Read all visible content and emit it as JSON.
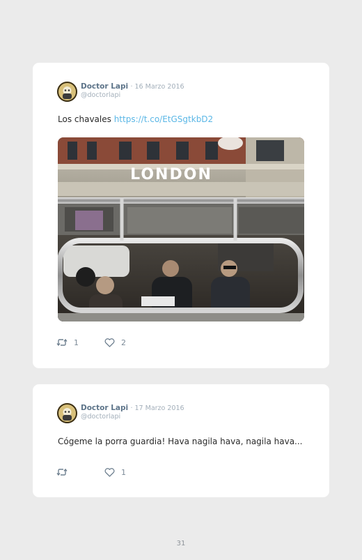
{
  "tweets": [
    {
      "author_name": "Doctor Lapi",
      "date": "· 16 Marzo 2016",
      "handle": "@doctorlapi",
      "text": "Los chavales",
      "link": "https://t.co/EtGSgtkbD2",
      "photo_sign_text": "LONDON",
      "retweet_count": "1",
      "like_count": "2"
    },
    {
      "author_name": "Doctor Lapi",
      "date": "· 17 Marzo 2016",
      "handle": "@doctorlapi",
      "text": "Cógeme la porra guardia! Hava nagila hava, nagila hava...",
      "retweet_count": "",
      "like_count": "1"
    }
  ],
  "page_number": "31",
  "colors": {
    "background": "#ebebeb",
    "card": "#ffffff",
    "name": "#5d7489",
    "link": "#5bb7e6",
    "muted": "#a3afba"
  }
}
